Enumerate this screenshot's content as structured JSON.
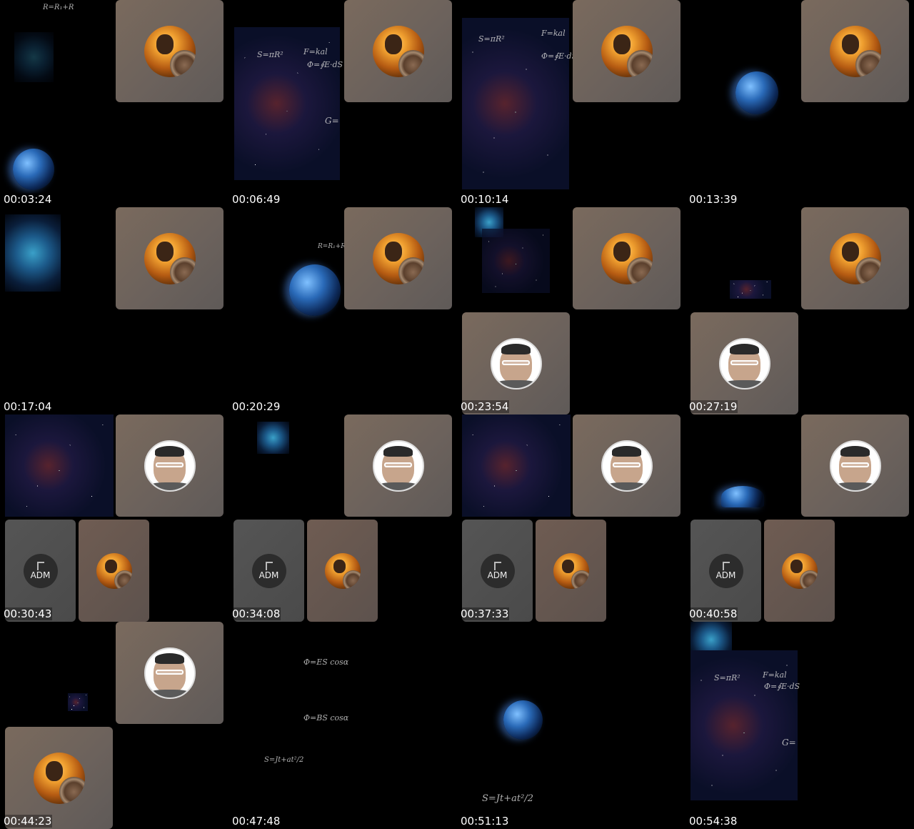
{
  "timestamps": [
    "00:03:24",
    "00:06:49",
    "00:10:14",
    "00:13:39",
    "00:17:04",
    "00:20:29",
    "00:23:54",
    "00:27:19",
    "00:30:43",
    "00:34:08",
    "00:37:33",
    "00:40:58",
    "00:44:23",
    "00:47:48",
    "00:51:13",
    "00:54:38"
  ],
  "participant_label": "ADM",
  "formulas": {
    "f1": "S=πR²",
    "f2": "F=kal",
    "f3": "Φ=∮E·dS",
    "f4": "G=",
    "f5": "Φ=ES cosα",
    "f6": "Φ=BS cosα",
    "f7": "S=Jt+at²/2",
    "f8": "R=R₁+R",
    "f9": "Φ=ES cosα",
    "f10": "Φ=BS cosα",
    "f11": "S=Jt+at²/2"
  },
  "colors": {
    "background": "#000000",
    "tile": "#6c625c",
    "tile_gray": "#4a4a4a",
    "text": "#ffffff"
  }
}
